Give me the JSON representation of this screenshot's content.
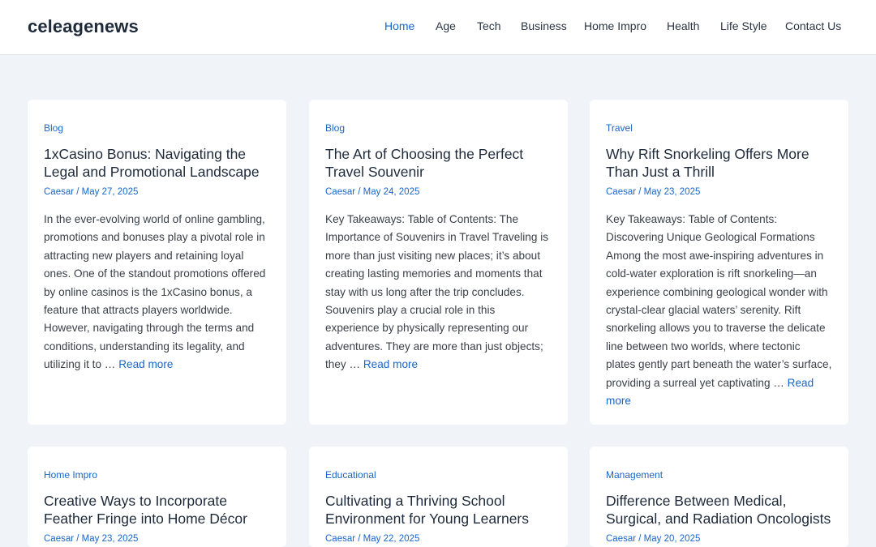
{
  "site": {
    "logo": "celeagenews"
  },
  "nav": {
    "items": [
      {
        "label": "Home",
        "active": true
      },
      {
        "label": "Age",
        "active": false
      },
      {
        "label": "Tech",
        "active": false
      },
      {
        "label": "Business",
        "active": false
      },
      {
        "label": "Home Impro",
        "active": false
      },
      {
        "label": "Health",
        "active": false
      },
      {
        "label": "Life Style",
        "active": false
      },
      {
        "label": "Contact Us",
        "active": false
      }
    ]
  },
  "colors": {
    "accent": "#1a66c9",
    "background": "#f0f4f8",
    "card": "#ffffff",
    "heading": "#1e2a3a"
  },
  "posts": [
    {
      "category": "Blog",
      "title": "1xCasino Bonus: Navigating the Legal and Promotional Landscape",
      "author": "Caesar",
      "separator": "/",
      "date": "May 27, 2025",
      "excerpt": "In the ever-evolving world of online gambling, promotions and bonuses play a pivotal role in attracting new players and retaining loyal ones. One of the standout promotions offered by online casinos is the 1xCasino bonus, a feature that attracts players worldwide. However, navigating through the terms and conditions, understanding its legality, and utilizing it to …",
      "read_more": "Read more"
    },
    {
      "category": "Blog",
      "title": "The Art of Choosing the Perfect Travel Souvenir",
      "author": "Caesar",
      "separator": "/",
      "date": "May 24, 2025",
      "excerpt": "Key Takeaways: Table of Contents: The Importance of Souvenirs in Travel Traveling is more than just visiting new places; it’s about creating lasting memories and moments that stay with us long after the trip concludes. Souvenirs play a crucial role in this experience by physically representing our adventures. They are more than just objects; they …",
      "read_more": "Read more"
    },
    {
      "category": "Travel",
      "title": "Why Rift Snorkeling Offers More Than Just a Thrill",
      "author": "Caesar",
      "separator": "/",
      "date": "May 23, 2025",
      "excerpt": "Key Takeaways: Table of Contents: Discovering Unique Geological Formations Among the most awe-inspiring adventures in cold-water exploration is rift snorkeling—an experience combining geological wonder with crystal-clear glacial waters’ serenity.  Rift snorkeling allows you to traverse the delicate line between two worlds, where tectonic plates gently part beneath the water’s surface, providing a surreal yet captivating …",
      "read_more": "Read more"
    },
    {
      "category": "Home Impro",
      "title": "Creative Ways to Incorporate Feather Fringe into Home Décor",
      "author": "Caesar",
      "separator": "/",
      "date": "May 23, 2025",
      "excerpt": "",
      "read_more": ""
    },
    {
      "category": "Educational",
      "title": "Cultivating a Thriving School Environment for Young Learners",
      "author": "Caesar",
      "separator": "/",
      "date": "May 22, 2025",
      "excerpt": "",
      "read_more": ""
    },
    {
      "category": "Management",
      "title": "Difference Between Medical, Surgical, and Radiation Oncologists",
      "author": "Caesar",
      "separator": "/",
      "date": "May 20, 2025",
      "excerpt": "",
      "read_more": ""
    }
  ]
}
